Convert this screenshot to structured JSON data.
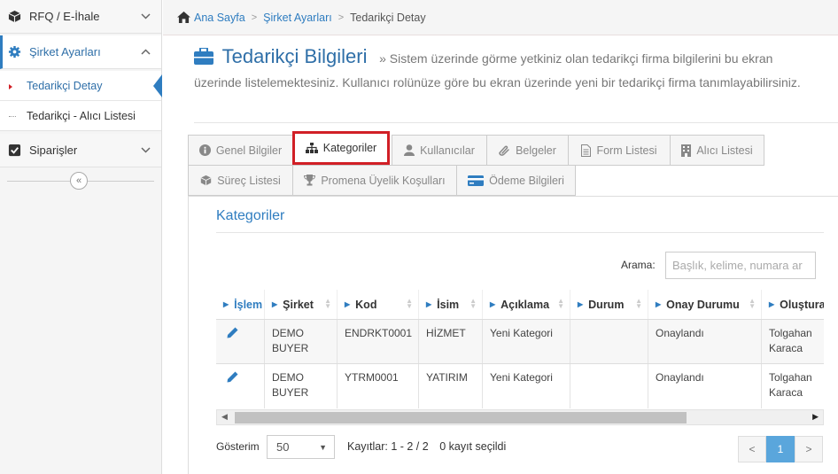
{
  "sidebar": {
    "items": [
      {
        "label": "RFQ / E-İhale",
        "icon": "cube-icon"
      },
      {
        "label": "Şirket Ayarları",
        "icon": "gear-icon"
      },
      {
        "label": "Siparişler",
        "icon": "checkbox-icon"
      }
    ],
    "subitems": [
      {
        "label": "Tedarikçi Detay"
      },
      {
        "label": "Tedarikçi - Alıcı Listesi"
      }
    ],
    "collapse_glyph": "«"
  },
  "breadcrumb": {
    "home": "Ana Sayfa",
    "section": "Şirket Ayarları",
    "current": "Tedarikçi Detay",
    "separator": ">"
  },
  "page": {
    "title": "Tedarikçi Bilgileri",
    "description": "» Sistem üzerinde görme yetkiniz olan tedarikçi firma bilgilerini bu ekran üzerinde listelemektesiniz. Kullanıcı rolünüze göre bu ekran üzerinde yeni bir tedarikçi firma tanımlayabilirsiniz."
  },
  "tabs": [
    {
      "label": "Genel Bilgiler",
      "icon": "info-icon"
    },
    {
      "label": "Kategoriler",
      "icon": "sitemap-icon"
    },
    {
      "label": "Kullanıcılar",
      "icon": "user-icon"
    },
    {
      "label": "Belgeler",
      "icon": "paperclip-icon"
    },
    {
      "label": "Form Listesi",
      "icon": "file-icon"
    },
    {
      "label": "Alıcı Listesi",
      "icon": "building-icon"
    },
    {
      "label": "Süreç Listesi",
      "icon": "cube-icon"
    },
    {
      "label": "Promena Üyelik Koşulları",
      "icon": "trophy-icon"
    },
    {
      "label": "Ödeme Bilgileri",
      "icon": "credit-card-icon"
    }
  ],
  "section": {
    "title": "Kategoriler",
    "search_label": "Arama:",
    "search_placeholder": "Başlık, kelime, numara ar"
  },
  "table": {
    "columns": [
      "İşlem",
      "Şirket",
      "Kod",
      "İsim",
      "Açıklama",
      "Durum",
      "Onay Durumu",
      "Oluşturan"
    ],
    "rows": [
      {
        "company": "DEMO BUYER",
        "code": "ENDRKT0001",
        "name": "HİZMET",
        "description": "Yeni Kategori",
        "status": "",
        "approval": "Onaylandı",
        "creator": "Tolgahan Karaca"
      },
      {
        "company": "DEMO BUYER",
        "code": "YTRM0001",
        "name": "YATIRIM",
        "description": "Yeni Kategori",
        "status": "",
        "approval": "Onaylandı",
        "creator": "Tolgahan Karaca"
      }
    ]
  },
  "footer": {
    "show_label": "Gösterim",
    "page_size": "50",
    "records": "Kayıtlar: 1 - 2 / 2",
    "selected": "0 kayıt seçildi",
    "prev": "<",
    "current_page": "1",
    "next": ">"
  },
  "colors": {
    "accent": "#2f7dc0",
    "highlight": "#d11f26",
    "pager_active": "#5aa6dc"
  }
}
